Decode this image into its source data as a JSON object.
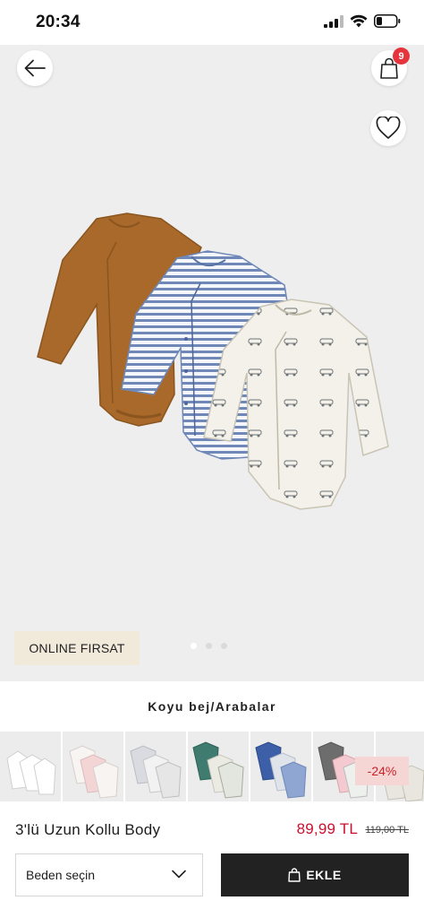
{
  "status_bar": {
    "time": "20:34"
  },
  "header": {
    "cart_count": "9"
  },
  "hero": {
    "promo_label": "ONLINE FIRSAT",
    "page_dots": 3,
    "active_dot": 0
  },
  "color": {
    "selected_name": "Koyu bej/Arabalar"
  },
  "swatches": {
    "discount_label": "-24%"
  },
  "product": {
    "name": "3'lü Uzun Kollu Body",
    "price": "89,99 TL",
    "old_price": "119,00 TL"
  },
  "actions": {
    "size_label": "Beden seçin",
    "add_label": "EKLE"
  },
  "colors": {
    "accent_red": "#e5343d",
    "price_red": "#c8102e",
    "promo_bg": "#f1e9da",
    "button_dark": "#222222"
  }
}
